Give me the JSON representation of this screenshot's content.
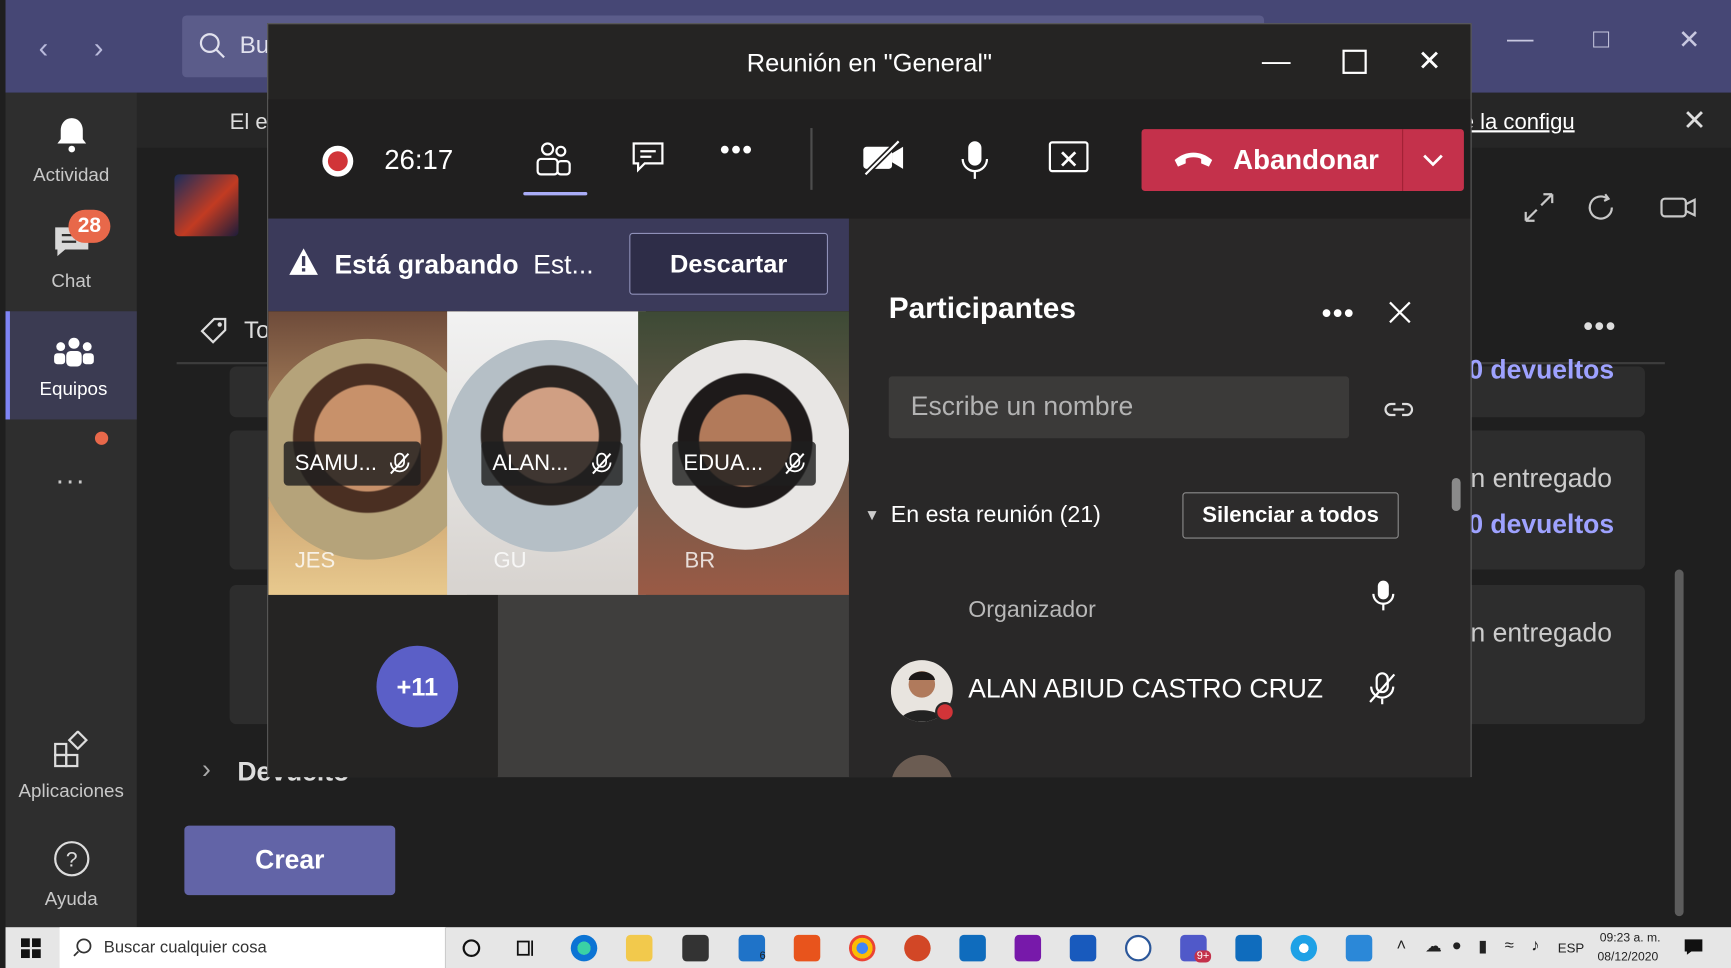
{
  "app": {
    "search_placeholder": "Bu",
    "banner_left": "El e",
    "banner_link": "e la configu"
  },
  "rail": {
    "items": [
      {
        "label": "Actividad"
      },
      {
        "label": "Chat",
        "badge": "28"
      },
      {
        "label": "Equipos"
      },
      {
        "label": "..."
      },
      {
        "label": "Aplicaciones"
      },
      {
        "label": "Ayuda"
      }
    ]
  },
  "background": {
    "tab_partial": "To",
    "card1_b": "0 devueltos",
    "card2_a": "n entregado",
    "card2_b": "0 devueltos",
    "card3_a": "n entregado",
    "section_devuelto": "Devuelto",
    "create_button": "Crear"
  },
  "meeting": {
    "title": "Reunión en \"General\"",
    "timer": "26:17",
    "leave_label": "Abandonar",
    "recording_title": "Está grabando",
    "recording_text": "Est...",
    "dismiss_label": "Descartar",
    "more_count": "+11",
    "tiles": [
      {
        "name": "SAMU...",
        "hidden_name": "JES"
      },
      {
        "name": "ALAN...",
        "hidden_name": "GU"
      },
      {
        "name": "EDUA...",
        "hidden_name": "BR"
      }
    ]
  },
  "participants": {
    "title": "Participantes",
    "search_placeholder": "Escribe un nombre",
    "section_label": "En esta reunión (21)",
    "mute_all_label": "Silenciar a todos",
    "organizer_label": "Organizador",
    "people": [
      {
        "name": "ALAN ABIUD CASTRO CRUZ"
      }
    ]
  },
  "taskbar": {
    "search_text": "Buscar cualquier cosa",
    "mail_badge": "6",
    "teams_badge": "9+",
    "language": "ESP",
    "time": "09:23 a. m.",
    "date": "08/12/2020"
  },
  "colors": {
    "accent": "#6264a7",
    "leave": "#c4314b",
    "recording": "#d13438",
    "badge": "#e8684a"
  }
}
